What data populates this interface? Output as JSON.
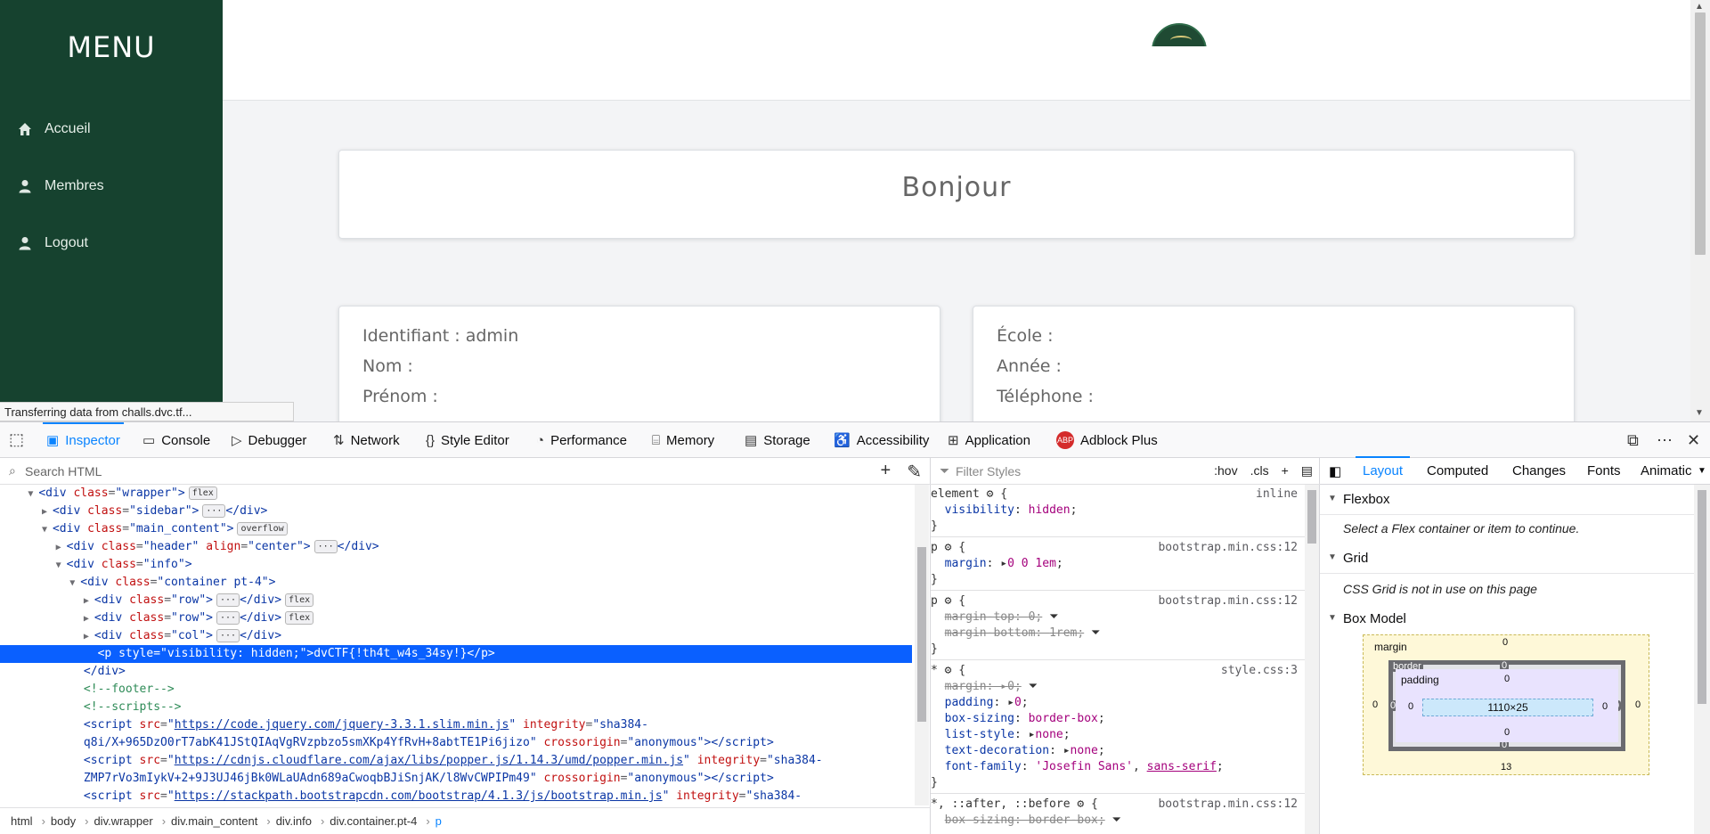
{
  "page": {
    "sidebar": {
      "title": "MENU",
      "items": [
        {
          "label": "Accueil",
          "icon": "home-icon"
        },
        {
          "label": "Membres",
          "icon": "user-icon"
        },
        {
          "label": "Logout",
          "icon": "user-icon"
        }
      ]
    },
    "greeting": "Bonjour",
    "left_card": [
      "Identifiant : admin",
      "Nom :",
      "Prénom :"
    ],
    "right_card": [
      "École :",
      "Année :",
      "Téléphone :"
    ],
    "status_text": "Transferring data from challs.dvc.tf..."
  },
  "devtools": {
    "tabs": [
      {
        "label": "Inspector",
        "icon": "inspector-icon"
      },
      {
        "label": "Console",
        "icon": "console-icon"
      },
      {
        "label": "Debugger",
        "icon": "debugger-icon"
      },
      {
        "label": "Network",
        "icon": "network-icon"
      },
      {
        "label": "Style Editor",
        "icon": "style-editor-icon"
      },
      {
        "label": "Performance",
        "icon": "performance-icon"
      },
      {
        "label": "Memory",
        "icon": "memory-icon"
      },
      {
        "label": "Storage",
        "icon": "storage-icon"
      },
      {
        "label": "Accessibility",
        "icon": "accessibility-icon"
      },
      {
        "label": "Application",
        "icon": "application-icon"
      },
      {
        "label": "Adblock Plus",
        "icon": "abp-icon"
      }
    ],
    "markup": {
      "search_placeholder": "Search HTML",
      "breadcrumbs": [
        "html",
        "body",
        "div.wrapper",
        "div.main_content",
        "div.info",
        "div.container.pt-4",
        "p"
      ]
    },
    "rules": {
      "filter_placeholder": "Filter Styles",
      "hov": ":hov",
      "cls": ".cls"
    },
    "layout": {
      "tabs": [
        "Layout",
        "Computed",
        "Changes",
        "Fonts",
        "Animatic"
      ],
      "flexbox_title": "Flexbox",
      "flexbox_note": "Select a Flex container or item to continue.",
      "grid_title": "Grid",
      "grid_note": "CSS Grid is not in use on this page",
      "boxmodel_title": "Box Model",
      "boxmodel": {
        "margin_label": "margin",
        "border_label": "border",
        "padding_label": "padding",
        "content": "1110×25",
        "margin_top": "0",
        "margin_bottom": "13",
        "margin_left": "0",
        "margin_right": "0",
        "border_top": "0",
        "border_bottom": "0",
        "border_left": "0",
        "border_right": "0",
        "padding_top": "0",
        "padding_bottom": "0",
        "padding_left": "0",
        "padding_right": "0"
      }
    }
  },
  "colors": {
    "sidebar": "#16422f",
    "accent": "#0a84ff",
    "selection": "#0a60ff"
  }
}
